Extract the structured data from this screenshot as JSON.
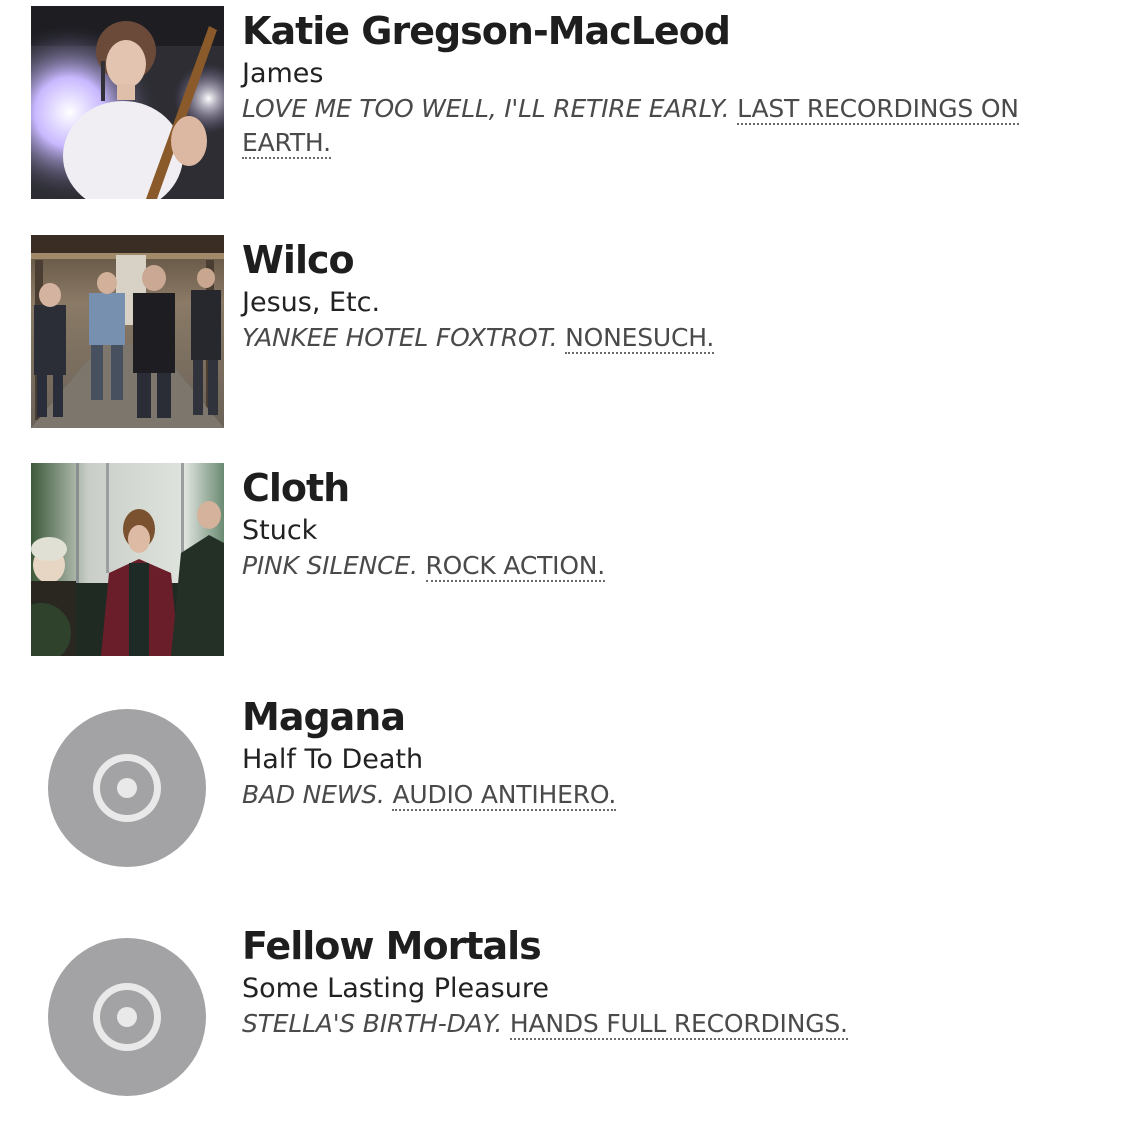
{
  "tracks": [
    {
      "artist": "Katie Gregson-MacLeod",
      "title": "James",
      "album": "LOVE ME TOO WELL, I'LL RETIRE EARLY.",
      "label": "LAST RECORDINGS ON EARTH.",
      "image": "artist-photo"
    },
    {
      "artist": "Wilco",
      "title": "Jesus, Etc.",
      "album": "YANKEE HOTEL FOXTROT.",
      "label": "NONESUCH.",
      "image": "artist-photo"
    },
    {
      "artist": "Cloth",
      "title": "Stuck",
      "album": "PINK SILENCE.",
      "label": "ROCK ACTION.",
      "image": "artist-photo"
    },
    {
      "artist": "Magana",
      "title": "Half To Death",
      "album": "BAD NEWS.",
      "label": "AUDIO ANTIHERO.",
      "image": "disc-placeholder-icon"
    },
    {
      "artist": "Fellow Mortals",
      "title": "Some Lasting Pleasure",
      "album": "STELLA'S BIRTH-DAY.",
      "label": "HANDS FULL RECORDINGS.",
      "image": "disc-placeholder-icon"
    }
  ],
  "colors": {
    "text": "#1e1e1e",
    "meta": "#4a4a4a",
    "disc": "#a3a3a5",
    "disc_inner": "#e9e9ea"
  }
}
